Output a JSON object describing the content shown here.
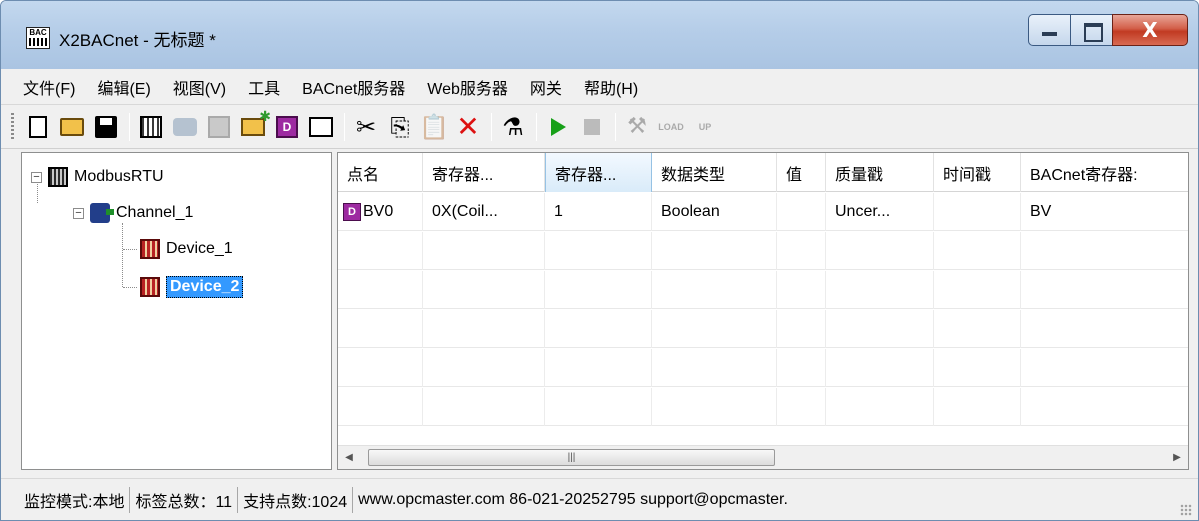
{
  "window": {
    "title": "X2BACnet - 无标题 *",
    "icon_text": "BAC",
    "close_glyph": "X"
  },
  "menu": [
    "文件(F)",
    "编辑(E)",
    "视图(V)",
    "工具",
    "BACnet服务器",
    "Web服务器",
    "网关",
    "帮助(H)"
  ],
  "toolbar": {
    "icons": [
      "new-file-icon",
      "open-folder-icon",
      "save-icon",
      "add-driver-icon",
      "add-channel-icon",
      "add-group-icon",
      "add-folder-icon",
      "add-device-icon",
      "properties-icon",
      "cut-icon",
      "copy-icon",
      "paste-icon",
      "delete-icon",
      "test-icon",
      "run-icon",
      "stop-icon",
      "tools-icon",
      "load-icon",
      "upload-icon"
    ],
    "cut_glyph": "✂",
    "copy_glyph": "⎘",
    "paste_glyph": "📋",
    "delete_glyph": "✕",
    "test_glyph": "⚗",
    "tools_glyph": "⚒",
    "load_text": "LOAD",
    "up_text": "UP"
  },
  "tree": {
    "root": "ModbusRTU",
    "channel": "Channel_1",
    "devices": [
      "Device_1",
      "Device_2"
    ],
    "selected": "Device_2"
  },
  "grid": {
    "columns": [
      "点名",
      "寄存器...",
      "寄存器...",
      "数据类型",
      "值",
      "质量戳",
      "时间戳",
      "BACnet寄存器:"
    ],
    "rows": [
      {
        "icon_text": "D",
        "cells": [
          "BV0",
          "0X(Coil...",
          "1",
          "Boolean",
          "",
          "Uncer...",
          "",
          "BV"
        ]
      }
    ],
    "arrow_left": "◀",
    "arrow_right": "▶"
  },
  "status": [
    "监控模式:本地",
    "标签总数：11",
    "支持点数:1024",
    "www.opcmaster.com 86-021-20252795 support@opcmaster."
  ],
  "colors": {
    "selection": "#3399ff",
    "title_gradient": "#b5cde8",
    "close_button": "#c13a22",
    "run_green": "#17a018"
  }
}
